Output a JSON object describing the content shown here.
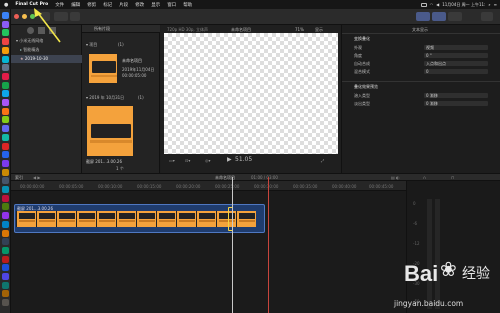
{
  "menubar": {
    "app_name": "Final Cut Pro",
    "items": [
      "文件",
      "编辑",
      "修剪",
      "标记",
      "片段",
      "修改",
      "显示",
      "窗口",
      "帮助"
    ],
    "datetime": "11月04日 周一 上午11:"
  },
  "library": {
    "library_name": "小米无线网络",
    "smart_collections": "智能精选",
    "event": "2019-10-30"
  },
  "browser": {
    "filter_label": "所有片段",
    "group1_title": "▾ 项目",
    "group1_count": "(1)",
    "project_title": "未命名项目",
    "project_date": "2019年11月04日",
    "project_duration": "00:00:05:00",
    "group2_title": "▾ 2019 年 10月31日",
    "group2_count": "(1)",
    "clip_name": "截屏 201...3.00.26",
    "footer_count": "1 个"
  },
  "viewer": {
    "format": "720p HD 30p, 立体声",
    "project_title": "未命名项目",
    "zoom": "71%",
    "view_label": "显示",
    "timecode": "51.05"
  },
  "inspector": {
    "header_title": "文本显示",
    "section_transform": "变换叠化",
    "row1_label": "外观",
    "row1_value": "视频",
    "row2_label": "角度",
    "row2_value": "0 °",
    "row3_label": "自动合成",
    "row3_value": "入点和出点",
    "row4_label": "混合模式",
    "row4_value": "0",
    "section_effect": "叠化效果预览",
    "row5_label": "溶入类型",
    "row5_value": "0 渐移",
    "row6_label": "淡出类型",
    "row6_value": "0 渐移"
  },
  "timeline": {
    "index_label": "索引",
    "project_title": "未命名项目",
    "timecode": "01:00 / 03:00",
    "ruler_ticks": [
      "00:00:00:00",
      "00:00:05:00",
      "00:00:10:00",
      "00:00:15:00",
      "00:00:20:00",
      "00:00:25:00",
      "00:00:30:00",
      "00:00:35:00",
      "00:00:40:00",
      "00:00:45:00"
    ],
    "clip_label": "截屏 201...3.00.26"
  },
  "audio_meters": {
    "scale": [
      "0",
      "-6",
      "-12",
      "-20",
      "-30",
      "-50"
    ]
  },
  "watermark": {
    "brand": "Bai",
    "brand_cn": "经验",
    "url": "jingyan.baidu.com"
  }
}
